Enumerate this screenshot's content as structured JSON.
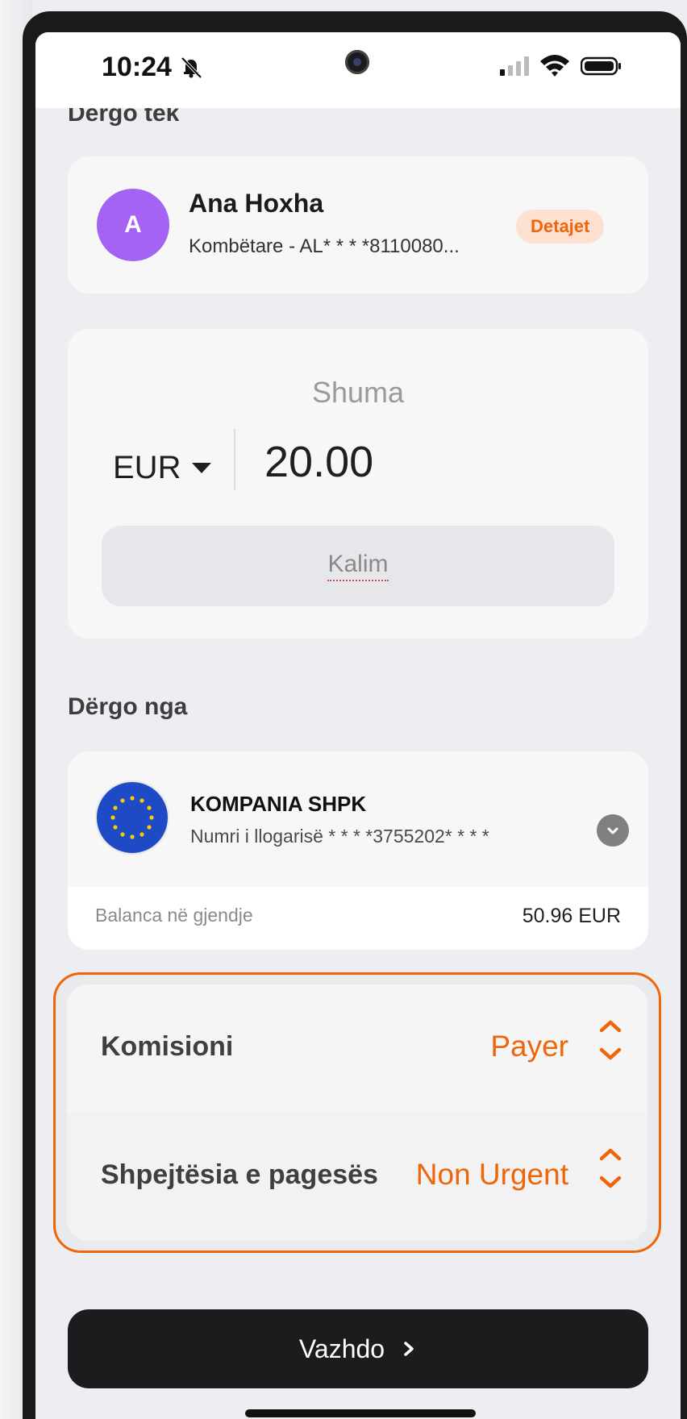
{
  "status_bar": {
    "time": "10:24"
  },
  "recipient_section": {
    "title": "Dergo tek",
    "name": "Ana Hoxha",
    "avatar_initial": "A",
    "account": "Kombëtare - AL* * * *8110080...",
    "details_label": "Detajet"
  },
  "amount": {
    "label": "Shuma",
    "currency": "EUR",
    "value": "20.00",
    "purpose": "Kalim"
  },
  "sender_section": {
    "title": "Dërgo nga",
    "company": "KOMPANIA SHPK",
    "account_number": "Numri i llogarisë * * * *3755202* * * *",
    "balance_label": "Balanca në gjendje",
    "balance_value": "50.96 EUR"
  },
  "options": {
    "commission_label": "Komisioni",
    "commission_value": "Payer",
    "speed_label": "Shpejtësia e pagesës",
    "speed_value": "Non Urgent"
  },
  "continue_label": "Vazhdo",
  "colors": {
    "accent": "#f0650a",
    "avatar": "#a463f2",
    "eu_blue": "#1e4bc5"
  }
}
